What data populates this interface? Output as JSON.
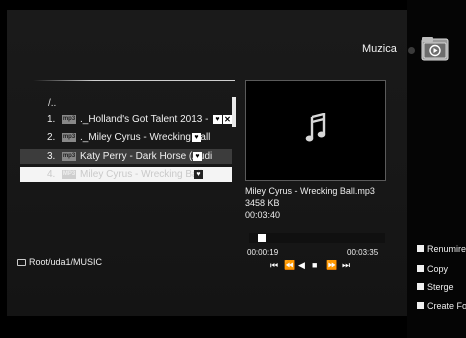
{
  "header": {
    "title": "Muzica",
    "folder_icon": "music-folder-icon"
  },
  "browser": {
    "parent_dir": "/..",
    "items": [
      {
        "index": "1.",
        "badge": "mp3",
        "name": "._Holland's Got Talent 2013 -",
        "favorite": true,
        "deleted": true
      },
      {
        "index": "2.",
        "badge": "mp3",
        "name": "._Miley Cyrus - Wrecking Ball",
        "favorite": true,
        "deleted": false
      },
      {
        "index": "3.",
        "badge": "mp3",
        "name": "Katy Perry - Dark Horse (Audi",
        "favorite": true,
        "deleted": false
      },
      {
        "index": "4.",
        "badge": "MP3",
        "name": "Miley Cyrus - Wrecking Ball",
        "favorite": true,
        "deleted": false
      }
    ],
    "path": "Root/uda1/MUSIC"
  },
  "now_playing": {
    "filename": "Miley Cyrus - Wrecking Ball.mp3",
    "size": "3458 KB",
    "duration": "00:03:40",
    "elapsed": "00:00:19",
    "total": "00:03:35",
    "progress": 0.09
  },
  "controls": {
    "skip_back": "⏮",
    "rewind": "⏪",
    "prev": "◀",
    "stop": "■",
    "fast_forward": "⏩",
    "skip_forward": "⏭"
  },
  "context_menu": {
    "rename": "Renumire",
    "copy": "Copy",
    "delete": "Sterge",
    "create_folder": "Create Fold"
  },
  "colors": {
    "background": "#000000",
    "panel": "#181818",
    "selection": "#3c3c3c",
    "highlight": "#f4f4f4"
  }
}
